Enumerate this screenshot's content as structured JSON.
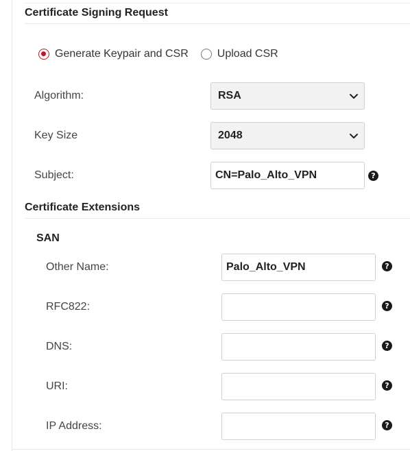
{
  "csr": {
    "title": "Certificate Signing Request",
    "mode_options": [
      {
        "label": "Generate Keypair and CSR",
        "selected": true
      },
      {
        "label": "Upload CSR",
        "selected": false
      }
    ],
    "algorithm": {
      "label": "Algorithm:",
      "value": "RSA"
    },
    "key_size": {
      "label": "Key Size",
      "value": "2048"
    },
    "subject": {
      "label": "Subject:",
      "value": "CN=Palo_Alto_VPN"
    }
  },
  "extensions": {
    "title": "Certificate Extensions",
    "san": {
      "title": "SAN",
      "fields": [
        {
          "label": "Other Name:",
          "value": "Palo_Alto_VPN"
        },
        {
          "label": "RFC822:",
          "value": ""
        },
        {
          "label": "DNS:",
          "value": ""
        },
        {
          "label": "URI:",
          "value": ""
        },
        {
          "label": "IP Address:",
          "value": ""
        }
      ]
    }
  },
  "icons": {
    "help": "?",
    "help_icon_name": "help-icon",
    "chevron_icon_name": "chevron-down-icon"
  },
  "colors": {
    "accent": "#c8102e",
    "help_icon_bg": "#1a1a1a",
    "select_bg": "#f2f2f2",
    "border": "#cfcfcf"
  }
}
